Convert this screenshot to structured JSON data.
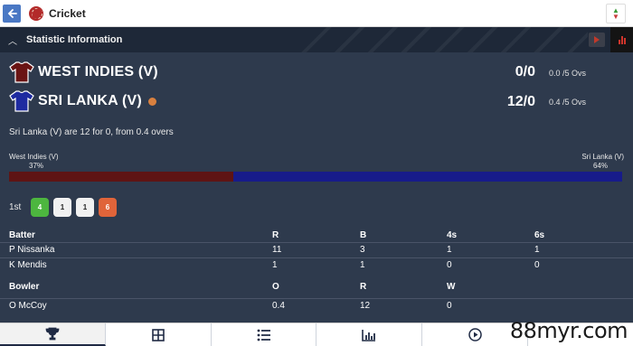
{
  "app": {
    "title": "Cricket"
  },
  "colors": {
    "team_a": "#5e1414",
    "team_b": "#171b8a",
    "dot_four": "#3a9b3a",
    "dot_six": "#e0643a",
    "live": "#d9803f"
  },
  "section": {
    "title": "Statistic Information"
  },
  "teams": [
    {
      "name": "WEST INDIES (V)",
      "score": "0/0",
      "overs": "0.0 /5 Ovs",
      "batting": false
    },
    {
      "name": "SRI LANKA (V)",
      "score": "12/0",
      "overs": "0.4 /5 Ovs",
      "batting": true
    }
  ],
  "summary": "Sri Lanka (V) are 12 for 0, from 0.4 overs",
  "win_probability": {
    "team_a": {
      "label": "West Indies (V)",
      "pct": "37%",
      "value": 37
    },
    "team_b": {
      "label": "Sri Lanka (V)",
      "pct": "64%",
      "value": 64
    }
  },
  "over": {
    "label": "1st",
    "balls": [
      "4",
      "1",
      "1",
      "6"
    ]
  },
  "batters": {
    "headers": [
      "Batter",
      "R",
      "B",
      "4s",
      "6s"
    ],
    "rows": [
      [
        "P Nissanka",
        "11",
        "3",
        "1",
        "1"
      ],
      [
        "K Mendis",
        "1",
        "1",
        "0",
        "0"
      ]
    ]
  },
  "bowlers": {
    "headers": [
      "Bowler",
      "O",
      "R",
      "W"
    ],
    "rows": [
      [
        "O McCoy",
        "0.4",
        "12",
        "0"
      ]
    ]
  },
  "nav": {
    "items": [
      "trophy-icon",
      "grid-icon",
      "list-icon",
      "chart-icon",
      "play-circle-icon"
    ]
  },
  "watermark": "88myr.com"
}
